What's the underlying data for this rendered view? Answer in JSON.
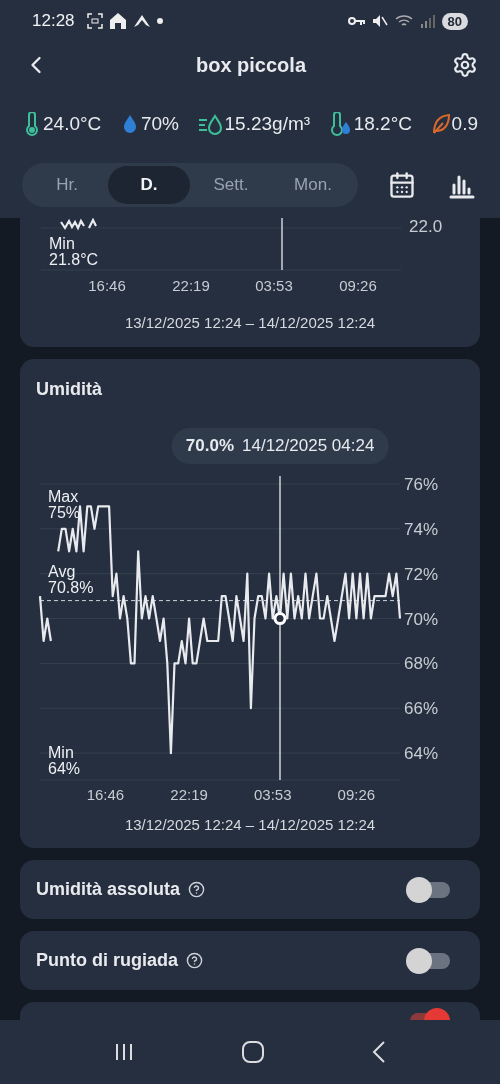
{
  "status_bar": {
    "time": "12:28",
    "battery": "80"
  },
  "header": {
    "title": "box piccola"
  },
  "metrics": [
    {
      "kind": "temperature",
      "value": "24.0°C",
      "color": "#3dbf9a"
    },
    {
      "kind": "humidity",
      "value": "70%",
      "color": "#2f7fd6"
    },
    {
      "kind": "absolute_humidity",
      "value": "15.23g/m³",
      "color": "#3dbf9a"
    },
    {
      "kind": "dew_point",
      "value": "18.2°C",
      "color": "#3dbf9a"
    },
    {
      "kind": "vpd",
      "value": "0.9",
      "color": "#d9692a"
    }
  ],
  "tabs": [
    {
      "label": "Hr.",
      "selected": false
    },
    {
      "label": "D.",
      "selected": true
    },
    {
      "label": "Sett.",
      "selected": false
    },
    {
      "label": "Mon.",
      "selected": false
    }
  ],
  "temperature_partial": {
    "stats": [
      {
        "kind": "min",
        "label": "Min",
        "value": "21.8°C"
      }
    ],
    "ytick": "22.0",
    "xticks": [
      "16:46",
      "22:19",
      "03:53",
      "09:26"
    ],
    "date_range": "13/12/2025 12:24 – 14/12/2025 12:24"
  },
  "humidity_card": {
    "title": "Umidità",
    "tooltip": {
      "value": "70.0%",
      "time": "14/12/2025 04:24"
    },
    "stats": [
      {
        "kind": "max",
        "label": "Max",
        "value": "75%"
      },
      {
        "kind": "avg",
        "value": "70.8%"
      },
      {
        "kind": "min",
        "label": "Min",
        "value": "64%"
      }
    ],
    "chart_data": {
      "type": "line",
      "ylim": [
        62.8,
        76
      ],
      "grid": true,
      "categories": [
        null,
        null,
        null,
        null,
        null,
        null,
        null,
        null,
        null,
        null,
        null,
        null,
        null,
        null,
        null,
        null,
        null,
        null,
        "16:46",
        null,
        null,
        null,
        null,
        null,
        null,
        null,
        null,
        null,
        null,
        null,
        null,
        null,
        null,
        null,
        null,
        null,
        null,
        null,
        null,
        null,
        null,
        "22:19",
        null,
        null,
        null,
        null,
        null,
        null,
        null,
        null,
        null,
        null,
        null,
        null,
        null,
        null,
        null,
        null,
        null,
        null,
        null,
        null,
        null,
        null,
        "03:53",
        null,
        null,
        null,
        null,
        null,
        null,
        null,
        null,
        null,
        null,
        null,
        null,
        null,
        null,
        null,
        null,
        null,
        null,
        null,
        null,
        null,
        null,
        "09:26",
        null,
        null,
        null,
        null,
        null,
        null,
        null,
        null,
        null,
        null,
        null,
        null
      ],
      "series": [
        {
          "color": "#e8eaee",
          "values": [
            71,
            69,
            70,
            69,
            null,
            73,
            74,
            74,
            73,
            74,
            73,
            75,
            73,
            75,
            75,
            74,
            75,
            75,
            75,
            75,
            71,
            72,
            70,
            71,
            70,
            68,
            68,
            73,
            70,
            71,
            70,
            71,
            70,
            69,
            70,
            68,
            64,
            68,
            68,
            69,
            68,
            70,
            68,
            68,
            69,
            70,
            69,
            69,
            69,
            69,
            71,
            71,
            70,
            69,
            71,
            70,
            69,
            72,
            66,
            70,
            71,
            71,
            70,
            72,
            70,
            71,
            70,
            72,
            70,
            72,
            70,
            71,
            70,
            72,
            70,
            71,
            72,
            70,
            70,
            71,
            70,
            69,
            70,
            71,
            72,
            70,
            72,
            70,
            72,
            70,
            72,
            70,
            71,
            71,
            71,
            71,
            72,
            71,
            72,
            70
          ]
        }
      ],
      "yticks": [
        {
          "value": 64,
          "label": "64%"
        },
        {
          "value": 66,
          "label": "66%"
        },
        {
          "value": 68,
          "label": "68%"
        },
        {
          "value": 70,
          "label": "70%"
        },
        {
          "value": 72,
          "label": "72%"
        },
        {
          "value": 74,
          "label": "74%"
        },
        {
          "value": 76,
          "label": "76%"
        }
      ],
      "ref_lines": [
        {
          "axis": "y",
          "value": 70.8,
          "label": "Avg"
        }
      ]
    },
    "date_range": "13/12/2025 12:24 – 14/12/2025 12:24"
  },
  "toggles": [
    {
      "label": "Umidità assoluta",
      "on": false
    },
    {
      "label": "Punto di rugiada",
      "on": false
    }
  ],
  "partial_toggle": {
    "on": true
  }
}
